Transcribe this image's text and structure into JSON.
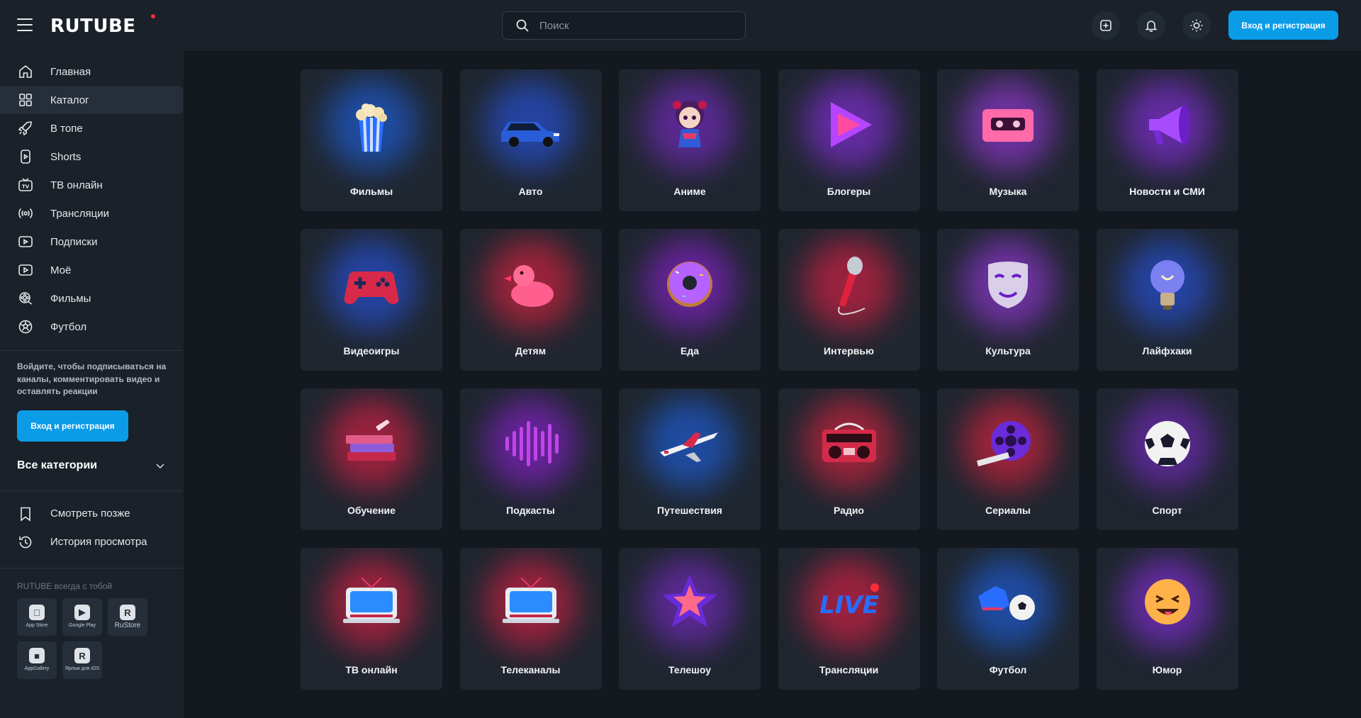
{
  "header": {
    "logo": "RUTUBE",
    "search_placeholder": "Поиск",
    "login_label": "Вход и регистрация"
  },
  "sidebar": {
    "nav": [
      {
        "label": "Главная",
        "icon": "home-icon"
      },
      {
        "label": "Каталог",
        "icon": "catalog-icon",
        "active": true
      },
      {
        "label": "В топе",
        "icon": "rocket-icon"
      },
      {
        "label": "Shorts",
        "icon": "shorts-icon"
      },
      {
        "label": "ТВ онлайн",
        "icon": "tv-icon"
      },
      {
        "label": "Трансляции",
        "icon": "broadcast-icon"
      },
      {
        "label": "Подписки",
        "icon": "subscriptions-icon"
      },
      {
        "label": "Моё",
        "icon": "my-icon"
      },
      {
        "label": "Фильмы",
        "icon": "film-reel-icon"
      },
      {
        "label": "Футбол",
        "icon": "football-icon"
      }
    ],
    "invite_text": "Войдите, чтобы подписываться на каналы, комментировать видео и оставлять реакции",
    "login_label": "Вход и регистрация",
    "all_categories": "Все категории",
    "library": [
      {
        "label": "Смотреть позже",
        "icon": "bookmark-icon"
      },
      {
        "label": "История просмотра",
        "icon": "history-icon"
      }
    ],
    "apps_title": "RUTUBE всегда с тобой",
    "apps": [
      {
        "label": "App Store",
        "icon": "apple-icon"
      },
      {
        "label": "Google Play",
        "icon": "google-play-icon"
      },
      {
        "label": "RuStore",
        "icon": "rustore-icon"
      },
      {
        "label": "AppGallery",
        "icon": "appgallery-icon"
      },
      {
        "label": "Ярлык для iOS",
        "icon": "ios-shortcut-icon"
      }
    ]
  },
  "categories": [
    {
      "label": "Фильмы",
      "icon": "popcorn-icon",
      "glow": "#1f6bff"
    },
    {
      "label": "Авто",
      "icon": "car-icon",
      "glow": "#2a5cff"
    },
    {
      "label": "Аниме",
      "icon": "anime-girl-icon",
      "glow": "#8a2be2"
    },
    {
      "label": "Блогеры",
      "icon": "play-triangle-icon",
      "glow": "#9b30ff"
    },
    {
      "label": "Музыка",
      "icon": "cassette-icon",
      "glow": "#b03cff"
    },
    {
      "label": "Новости и СМИ",
      "icon": "megaphone-icon",
      "glow": "#9b30ff"
    },
    {
      "label": "Видеоигры",
      "icon": "gamepad-icon",
      "glow": "#2a5cff"
    },
    {
      "label": "Детям",
      "icon": "duck-icon",
      "glow": "#ff2244"
    },
    {
      "label": "Еда",
      "icon": "donut-icon",
      "glow": "#a020f0"
    },
    {
      "label": "Интервью",
      "icon": "microphone-icon",
      "glow": "#ff1f4b"
    },
    {
      "label": "Культура",
      "icon": "theater-mask-icon",
      "glow": "#b03cff"
    },
    {
      "label": "Лайфхаки",
      "icon": "lightbulb-icon",
      "glow": "#2a5cff"
    },
    {
      "label": "Обучение",
      "icon": "books-icon",
      "glow": "#ff1f4b"
    },
    {
      "label": "Подкасты",
      "icon": "sound-wave-icon",
      "glow": "#a020f0"
    },
    {
      "label": "Путешествия",
      "icon": "airplane-icon",
      "glow": "#1f6bff"
    },
    {
      "label": "Радио",
      "icon": "boombox-icon",
      "glow": "#ff2244"
    },
    {
      "label": "Сериалы",
      "icon": "film-reel-icon",
      "glow": "#ff2244"
    },
    {
      "label": "Спорт",
      "icon": "soccer-ball-icon",
      "glow": "#8a2be2"
    },
    {
      "label": "ТВ онлайн",
      "icon": "tv-set-icon",
      "glow": "#ff1f4b"
    },
    {
      "label": "Телеканалы",
      "icon": "tv-set-icon",
      "glow": "#ff1f4b"
    },
    {
      "label": "Телешоу",
      "icon": "star-icon",
      "glow": "#8a2be2"
    },
    {
      "label": "Трансляции",
      "icon": "live-icon",
      "glow": "#ff1f4b"
    },
    {
      "label": "Футбол",
      "icon": "boots-ball-icon",
      "glow": "#1f6bff"
    },
    {
      "label": "Юмор",
      "icon": "laughing-emoji-icon",
      "glow": "#9b30ff"
    }
  ]
}
